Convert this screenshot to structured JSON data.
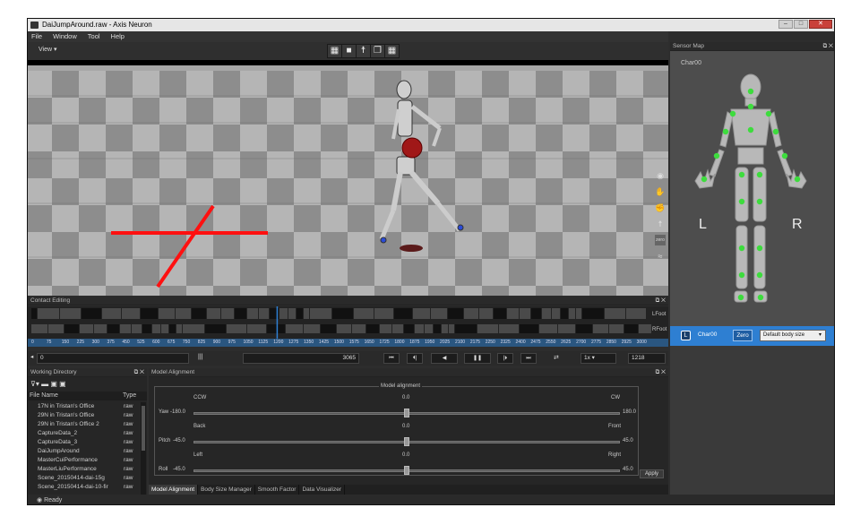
{
  "window": {
    "title": "DaiJumpAround.raw - Axis Neuron",
    "minimize": "–",
    "maximize": "□",
    "close": "✕"
  },
  "menu": [
    "File",
    "Window",
    "Tool",
    "Help"
  ],
  "toolbar": {
    "view_label": "View",
    "icons": [
      "checker-icon",
      "camera-icon",
      "figure-icon",
      "window-icon",
      "checker-icon"
    ]
  },
  "viewport": {
    "side_tools": [
      "record-icon",
      "hand-icon",
      "hand-fist-icon",
      "tpose-icon",
      "zero-icon",
      "wave-icon"
    ],
    "zero_label": "zero"
  },
  "contact_editing": {
    "title": "Contact Editing",
    "track_labels": [
      "LFoot",
      "RFoot"
    ],
    "ruler_ticks": [
      "0",
      "75",
      "150",
      "225",
      "300",
      "375",
      "450",
      "525",
      "600",
      "675",
      "750",
      "825",
      "900",
      "975",
      "1050",
      "1125",
      "1200",
      "1275",
      "1350",
      "1425",
      "1500",
      "1575",
      "1650",
      "1725",
      "1800",
      "1875",
      "1950",
      "2025",
      "2100",
      "2175",
      "2250",
      "2325",
      "2400",
      "2475",
      "2550",
      "2625",
      "2700",
      "2775",
      "2850",
      "2925",
      "3000"
    ],
    "start_field": "0",
    "end_field": "3065",
    "speed": "1x",
    "frame": "1218",
    "playhead_fraction": 0.4
  },
  "working_directory": {
    "title": "Working Directory",
    "col_name": "File Name",
    "col_type": "Type",
    "files": [
      {
        "name": "17N in Tristan's Office",
        "type": "raw"
      },
      {
        "name": "29N in Tristan's Office",
        "type": "raw"
      },
      {
        "name": "29N in Tristan's Office 2",
        "type": "raw"
      },
      {
        "name": "CaptureData_2",
        "type": "raw"
      },
      {
        "name": "CaptureData_3",
        "type": "raw"
      },
      {
        "name": "DaiJumpAround",
        "type": "raw"
      },
      {
        "name": "MasterCuiPerformance",
        "type": "raw"
      },
      {
        "name": "MasterLiuPerformance",
        "type": "raw"
      },
      {
        "name": "Scene_20150414-dai-15g",
        "type": "raw"
      },
      {
        "name": "Scene_20150414-dai-10-fir",
        "type": "raw"
      }
    ]
  },
  "model_alignment": {
    "title": "Model Alignment",
    "group_title": "Model alignment",
    "yaw": {
      "label": "Yaw",
      "left": "CCW",
      "center": "0.0",
      "right": "CW",
      "min": "-180.0",
      "max": "180.0"
    },
    "pitch": {
      "label": "Pitch",
      "left": "Back",
      "center": "0.0",
      "right": "Front",
      "min": "-45.0",
      "max": "45.0"
    },
    "roll": {
      "label": "Roll",
      "left": "Left",
      "center": "0.0",
      "right": "Right",
      "min": "-45.0",
      "max": "45.0"
    },
    "apply": "Apply",
    "tabs": [
      "Model Alignment",
      "Body Size Manager",
      "Smooth Factor",
      "Data Visualizer"
    ]
  },
  "sensor_map": {
    "title": "Sensor Map",
    "char_name": "Char00",
    "left_label": "L",
    "right_label": "R",
    "char_bar": {
      "badge": "L",
      "name": "Char00",
      "zero": "Zero",
      "body_size": "Default body size"
    }
  },
  "status": {
    "text": "Ready"
  },
  "colors": {
    "accent": "#2e7fd2",
    "sensor": "#3ddc3d",
    "contact_line": "#ff1010"
  }
}
